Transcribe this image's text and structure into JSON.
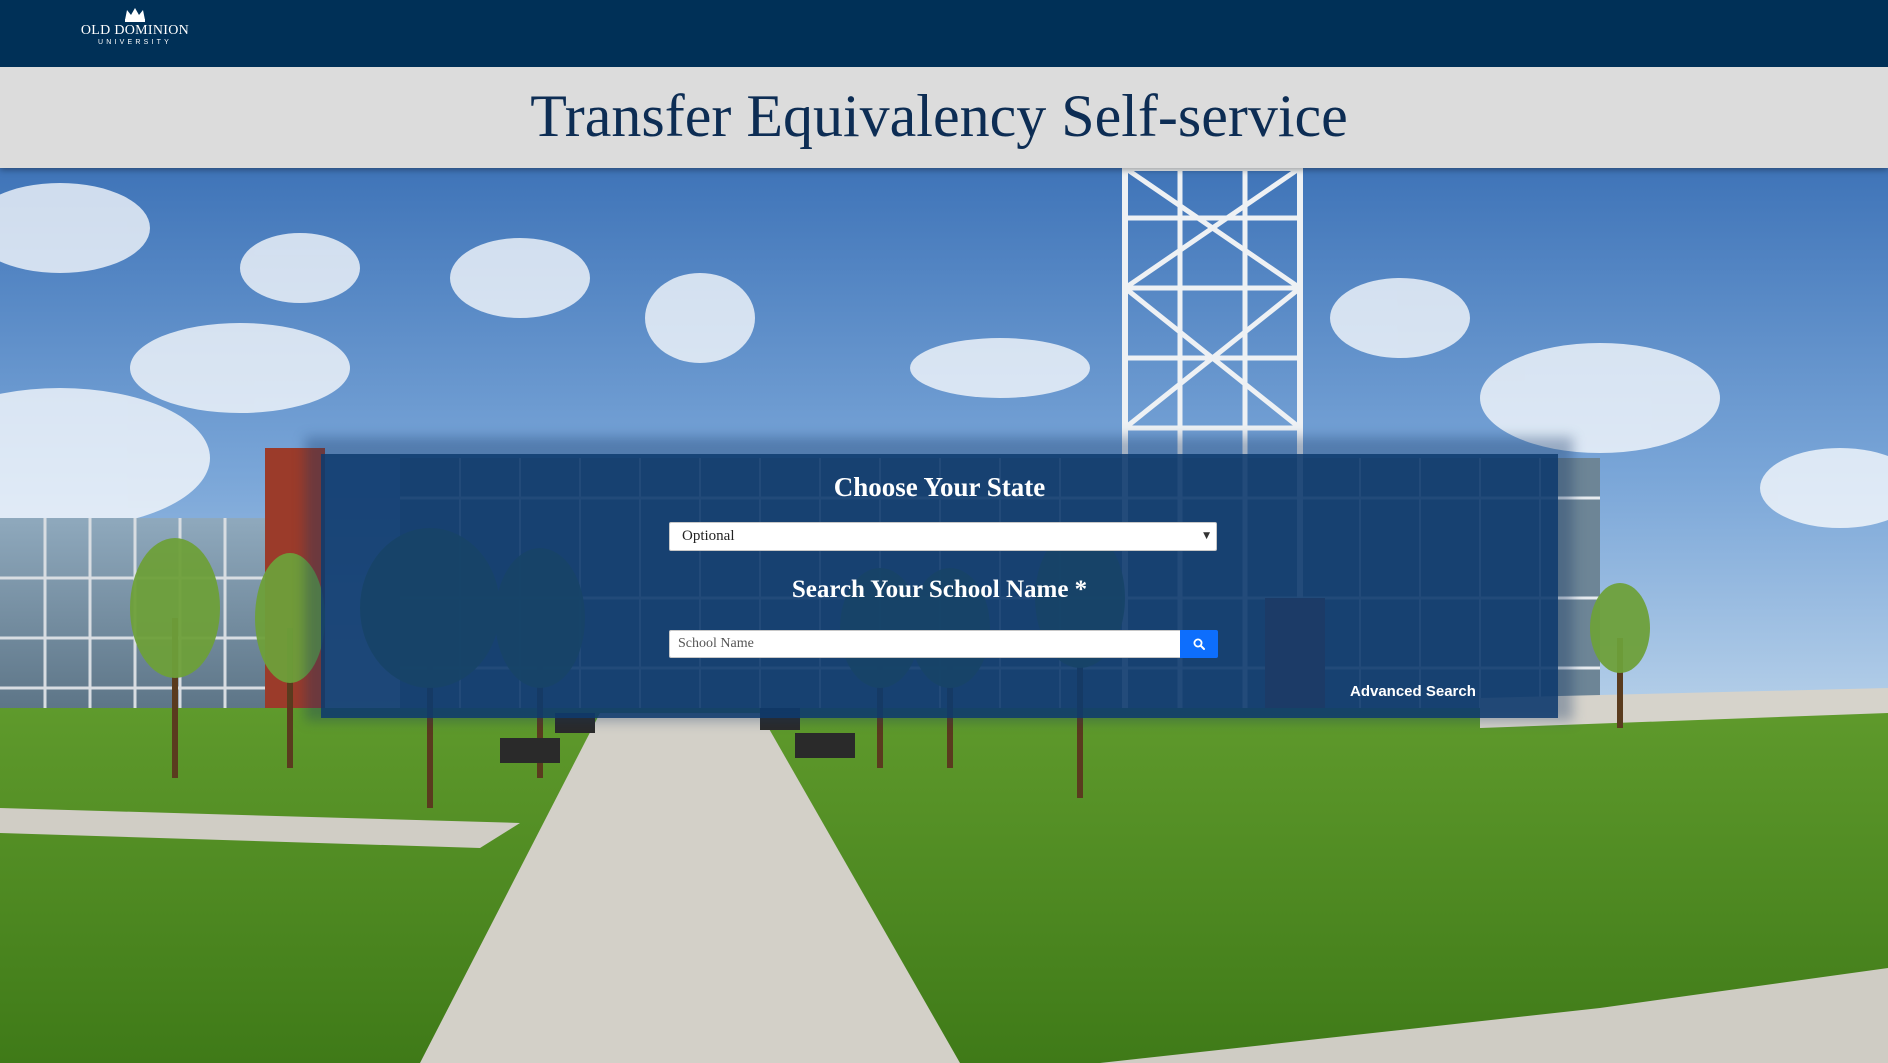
{
  "header": {
    "logo_line1": "OLD DOMINION",
    "logo_line2": "UNIVERSITY",
    "logo_icon": "crown-icon",
    "background_color": "#003057"
  },
  "title_band": {
    "title": "Transfer Equivalency Self-service",
    "title_color": "#0d2d54",
    "background_color": "#dcdcdc"
  },
  "search_panel": {
    "state_heading": "Choose Your State",
    "state_select": {
      "selected_value": "Optional"
    },
    "school_heading": "Search Your School Name *",
    "school_input": {
      "value": "",
      "placeholder": "School Name"
    },
    "search_button_icon": "search-icon",
    "search_button_color": "#0d6efd",
    "advanced_search_label": "Advanced Search",
    "panel_color": "#0e3a6e"
  },
  "background": {
    "description_icon": "campus-photo"
  }
}
